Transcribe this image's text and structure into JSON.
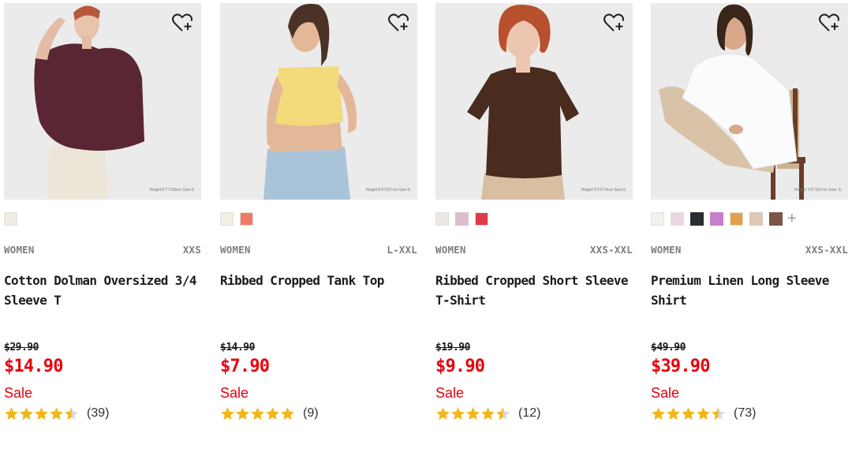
{
  "colors": {
    "accent_red": "#e8000b",
    "star_gold": "#f2b619",
    "text_dark": "#1b1b1b",
    "text_muted": "#7d7d7d"
  },
  "products": [
    {
      "image_subject": "model in plum oversized dolman top with cream pants",
      "model_info": "Height:5'7\"/169cm Size:S",
      "swatches": [
        "#efece3"
      ],
      "show_more": false,
      "gender": "WOMEN",
      "sizes": "XXS",
      "name": "Cotton Dolman Oversized 3/4 Sleeve T",
      "original_price": "$29.90",
      "price": "$14.90",
      "sale_label": "Sale",
      "rating": 4.5,
      "reviews": "(39)"
    },
    {
      "image_subject": "model in yellow ribbed cropped tank top with light denim",
      "model_info": "Height:5'6\"/167cm Size:S",
      "swatches": [
        "#f3efe4",
        "#ef7a67"
      ],
      "show_more": false,
      "gender": "WOMEN",
      "sizes": "L-XXL",
      "name": "Ribbed Cropped Tank Top",
      "original_price": "$14.90",
      "price": "$7.90",
      "sale_label": "Sale",
      "rating": 5,
      "reviews": "(9)"
    },
    {
      "image_subject": "model in brown ribbed cropped short sleeve t-shirt",
      "model_info": "Height:5'9\"/174cm Size:S",
      "swatches": [
        "#ece9e2",
        "#dcbfcf",
        "#e03c48"
      ],
      "show_more": false,
      "gender": "WOMEN",
      "sizes": "XXS-XXL",
      "name": "Ribbed Cropped Short Sleeve T-Shirt",
      "original_price": "$19.90",
      "price": "$9.90",
      "sale_label": "Sale",
      "rating": 4.5,
      "reviews": "(12)"
    },
    {
      "image_subject": "model in white linen long sleeve shirt seated on wooden chair",
      "model_info": "Height: 5'6\"/167cm Size: S",
      "swatches": [
        "#f3f1ec",
        "#e8d7e2",
        "#2a2c33",
        "#c87fca",
        "#e2a04b",
        "#dcc8b8",
        "#7d5648"
      ],
      "show_more": true,
      "gender": "WOMEN",
      "sizes": "XXS-XXL",
      "name": "Premium Linen Long Sleeve Shirt",
      "original_price": "$49.90",
      "price": "$39.90",
      "sale_label": "Sale",
      "rating": 4.5,
      "reviews": "(73)"
    }
  ]
}
